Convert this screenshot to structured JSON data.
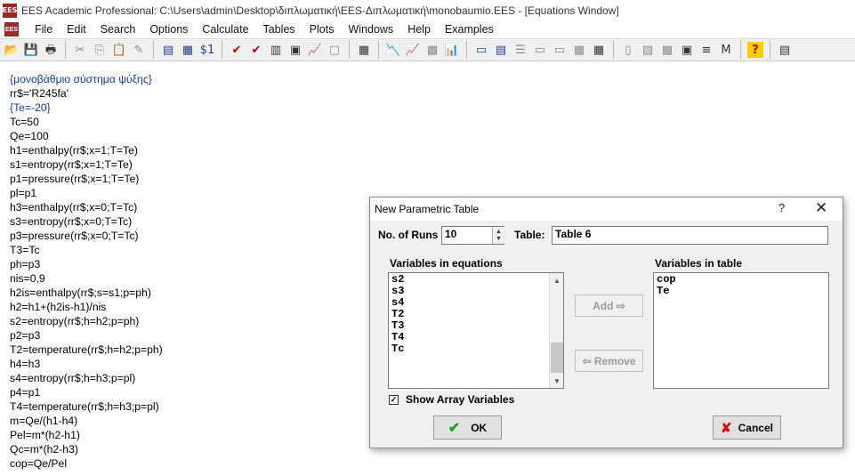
{
  "window": {
    "title": "EES Academic Professional:  C:\\Users\\admin\\Desktop\\διπλωματική\\EES-Διπλωματική\\monobaumio.EES - [Equations Window]",
    "app_icon_text": "EES"
  },
  "menu": [
    "File",
    "Edit",
    "Search",
    "Options",
    "Calculate",
    "Tables",
    "Plots",
    "Windows",
    "Help",
    "Examples"
  ],
  "toolbar": {
    "groups": [
      [
        "open-icon",
        "save-icon",
        "print-icon"
      ],
      [
        "cut-icon",
        "copy-icon",
        "paste-icon",
        "check-unit-icon"
      ],
      [
        "info-icon",
        "solver-icon",
        "units-icon"
      ],
      [
        "check-icon",
        "solve-icon",
        "table-run-icon",
        "array-icon",
        "new-plot-icon",
        "gray-plot-icon"
      ],
      [
        "parametric-table-icon"
      ],
      [
        "plot1-icon",
        "plot2-icon",
        "plot3-icon",
        "plot4-icon"
      ],
      [
        "window1-icon",
        "window2-icon",
        "window3-icon",
        "window4-icon",
        "window5-icon",
        "window6-icon",
        "window7-icon"
      ],
      [
        "diagram1-icon",
        "diagram2-icon",
        "diagram3-icon",
        "diagram4-icon",
        "diagram5-icon",
        "macro-icon"
      ],
      [
        "help-icon"
      ],
      [
        "calculator-icon"
      ]
    ]
  },
  "equations": [
    {
      "text": "{μονοβάθμιο σύστημα ψύξης}",
      "comment": true
    },
    {
      "text": "rr$='R245fa'",
      "comment": false
    },
    {
      "text": "{Te=-20}",
      "comment": true
    },
    {
      "text": "Tc=50",
      "comment": false
    },
    {
      "text": "Qe=100",
      "comment": false
    },
    {
      "text": "h1=enthalpy(rr$;x=1;T=Te)",
      "comment": false
    },
    {
      "text": "s1=entropy(rr$;x=1;T=Te)",
      "comment": false
    },
    {
      "text": "p1=pressure(rr$;x=1;T=Te)",
      "comment": false
    },
    {
      "text": "pl=p1",
      "comment": false
    },
    {
      "text": "h3=enthalpy(rr$;x=0;T=Tc)",
      "comment": false
    },
    {
      "text": "s3=entropy(rr$;x=0;T=Tc)",
      "comment": false
    },
    {
      "text": "p3=pressure(rr$;x=0;T=Tc)",
      "comment": false
    },
    {
      "text": "T3=Tc",
      "comment": false
    },
    {
      "text": "ph=p3",
      "comment": false
    },
    {
      "text": "nis=0,9",
      "comment": false
    },
    {
      "text": "h2is=enthalpy(rr$;s=s1;p=ph)",
      "comment": false
    },
    {
      "text": "h2=h1+(h2is-h1)/nis",
      "comment": false
    },
    {
      "text": "s2=entropy(rr$;h=h2;p=ph)",
      "comment": false
    },
    {
      "text": "p2=p3",
      "comment": false
    },
    {
      "text": "T2=temperature(rr$;h=h2;p=ph)",
      "comment": false
    },
    {
      "text": "h4=h3",
      "comment": false
    },
    {
      "text": "s4=entropy(rr$;h=h3;p=pl)",
      "comment": false
    },
    {
      "text": "p4=p1",
      "comment": false
    },
    {
      "text": "T4=temperature(rr$;h=h3;p=pl)",
      "comment": false
    },
    {
      "text": "m=Qe/(h1-h4)",
      "comment": false
    },
    {
      "text": "Pel=m*(h2-h1)",
      "comment": false
    },
    {
      "text": "Qc=m*(h2-h3)",
      "comment": false
    },
    {
      "text": "cop=Qe/Pel",
      "comment": false
    }
  ],
  "dialog": {
    "title": "New Parametric Table",
    "help_glyph": "?",
    "close_glyph": "✕",
    "runs_label": "No. of Runs",
    "runs_value": "10",
    "table_label": "Table:",
    "table_value": "Table 6",
    "vars_in_equations_label": "Variables in equations",
    "vars_in_equations": [
      "s2",
      "s3",
      "s4",
      "T2",
      "T3",
      "T4",
      "Tc"
    ],
    "vars_in_table_label": "Variables in table",
    "vars_in_table": [
      "cop",
      "Te"
    ],
    "add_label": "Add ⇨",
    "remove_label": "⇦ Remove",
    "show_array_label": "Show Array Variables",
    "show_array_checked": true,
    "ok_label": "OK",
    "cancel_label": "Cancel"
  }
}
